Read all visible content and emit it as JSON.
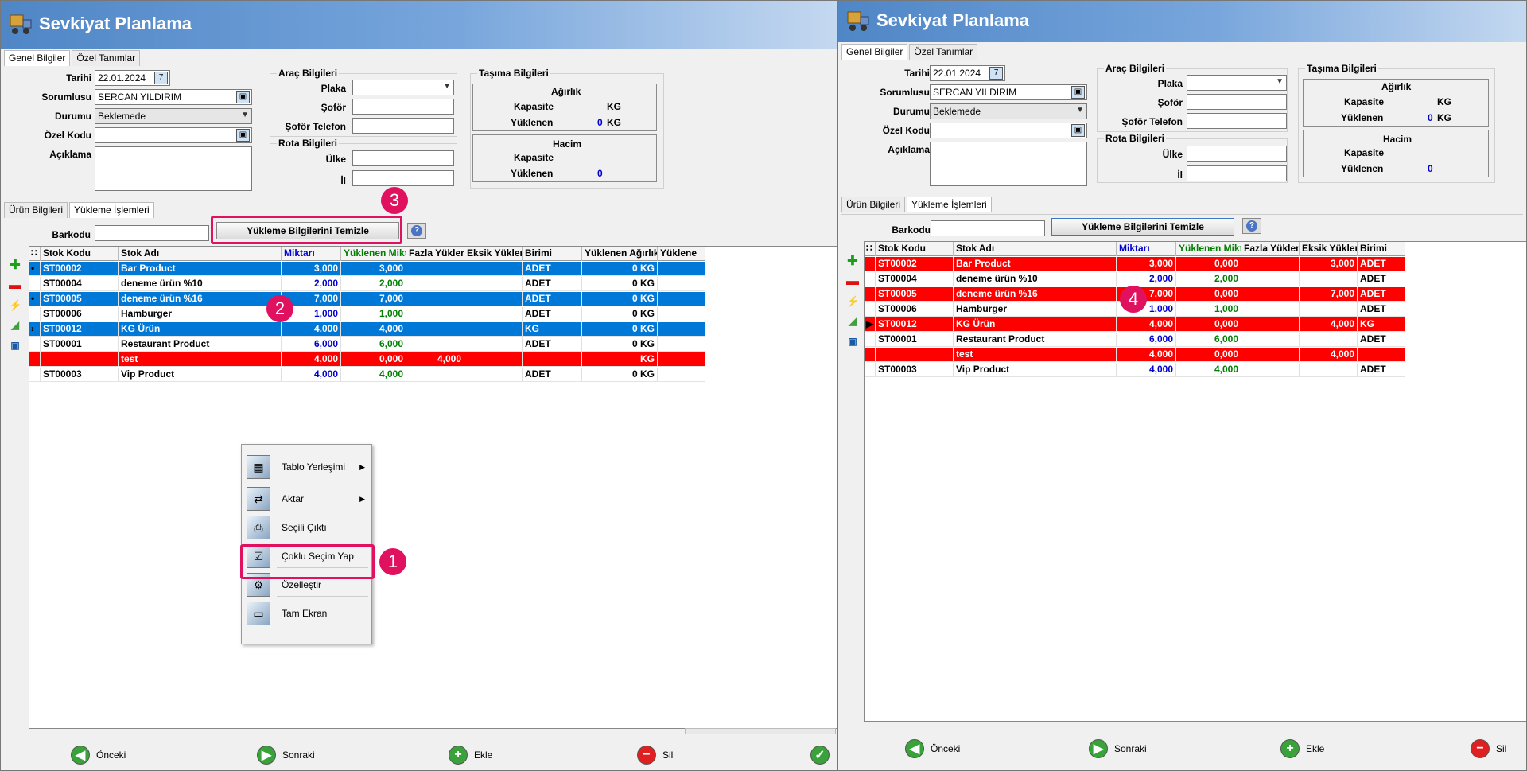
{
  "app_title": "Sevkiyat Planlama",
  "top_tabs": [
    "Genel Bilgiler",
    "Özel Tanımlar"
  ],
  "form": {
    "tarih_label": "Tarihi",
    "tarih_value": "22.01.2024",
    "sorumlu_label": "Sorumlusu",
    "sorumlu_value": "SERCAN YILDIRIM",
    "durum_label": "Durumu",
    "durum_value": "Beklemede",
    "ozel_kod_label": "Özel Kodu",
    "ozel_kod_value": "",
    "aciklama_label": "Açıklama",
    "aciklama_value": ""
  },
  "arac": {
    "title": "Araç Bilgileri",
    "plaka": "Plaka",
    "sofor": "Şoför",
    "sofor_tel": "Şoför Telefon"
  },
  "rota": {
    "title": "Rota Bilgileri",
    "ulke": "Ülke",
    "il": "İl"
  },
  "tasima": {
    "title": "Taşıma Bilgileri",
    "agirlik_title": "Ağırlık",
    "kapasite": "Kapasite",
    "yuklenen": "Yüklenen",
    "kg": "KG",
    "agirlik_yuklenen_value": "0",
    "hacim_title": "Hacim",
    "hacim_yuklenen_value": "0"
  },
  "lower_tabs": [
    "Ürün Bilgileri",
    "Yükleme İşlemleri"
  ],
  "barkod_label": "Barkodu",
  "clear_button": "Yükleme Bilgilerini Temizle",
  "grid_left": {
    "columns": [
      "Stok Kodu",
      "Stok Adı",
      "Miktarı",
      "Yüklenen Miktar",
      "Fazla Yüklenen",
      "Eksik Yüklenen",
      "Birimi",
      "Yüklenen Ağırlık",
      "Yüklene"
    ],
    "rows": [
      {
        "marker": "•",
        "style": "sel",
        "kod": "ST00002",
        "ad": "Bar Product",
        "miktar": "3,000",
        "yuklenen": "3,000",
        "fazla": "",
        "eksik": "",
        "birim": "ADET",
        "agirlik": "0 KG"
      },
      {
        "marker": "",
        "style": "",
        "kod": "ST00004",
        "ad": "deneme ürün %10",
        "miktar": "2,000",
        "yuklenen": "2,000",
        "fazla": "",
        "eksik": "",
        "birim": "ADET",
        "agirlik": "0 KG"
      },
      {
        "marker": "•",
        "style": "sel",
        "kod": "ST00005",
        "ad": "deneme ürün %16",
        "miktar": "7,000",
        "yuklenen": "7,000",
        "fazla": "",
        "eksik": "",
        "birim": "ADET",
        "agirlik": "0 KG"
      },
      {
        "marker": "",
        "style": "",
        "kod": "ST00006",
        "ad": "Hamburger",
        "miktar": "1,000",
        "yuklenen": "1,000",
        "fazla": "",
        "eksik": "",
        "birim": "ADET",
        "agirlik": "0 KG"
      },
      {
        "marker": "›",
        "style": "sel",
        "kod": "ST00012",
        "ad": "KG Ürün",
        "miktar": "4,000",
        "yuklenen": "4,000",
        "fazla": "",
        "eksik": "",
        "birim": "KG",
        "agirlik": "0 KG"
      },
      {
        "marker": "",
        "style": "",
        "kod": "ST00001",
        "ad": "Restaurant Product",
        "miktar": "6,000",
        "yuklenen": "6,000",
        "fazla": "",
        "eksik": "",
        "birim": "ADET",
        "agirlik": "0 KG"
      },
      {
        "marker": "",
        "style": "red",
        "kod": "",
        "ad": "test",
        "miktar": "4,000",
        "yuklenen": "0,000",
        "fazla": "4,000",
        "eksik": "",
        "birim": "",
        "agirlik": "KG"
      },
      {
        "marker": "",
        "style": "",
        "kod": "ST00003",
        "ad": "Vip Product",
        "miktar": "4,000",
        "yuklenen": "4,000",
        "fazla": "",
        "eksik": "",
        "birim": "ADET",
        "agirlik": "0 KG"
      }
    ]
  },
  "grid_right": {
    "columns": [
      "Stok Kodu",
      "Stok Adı",
      "Miktarı",
      "Yüklenen Miktar",
      "Fazla Yüklenen",
      "Eksik Yüklenen",
      "Birimi"
    ],
    "rows": [
      {
        "marker": "",
        "style": "red",
        "kod": "ST00002",
        "ad": "Bar Product",
        "miktar": "3,000",
        "yuklenen": "0,000",
        "fazla": "",
        "eksik": "3,000",
        "birim": "ADET"
      },
      {
        "marker": "",
        "style": "",
        "kod": "ST00004",
        "ad": "deneme ürün %10",
        "miktar": "2,000",
        "yuklenen": "2,000",
        "fazla": "",
        "eksik": "",
        "birim": "ADET"
      },
      {
        "marker": "",
        "style": "red",
        "kod": "ST00005",
        "ad": "deneme ürün %16",
        "miktar": "7,000",
        "yuklenen": "0,000",
        "fazla": "",
        "eksik": "7,000",
        "birim": "ADET"
      },
      {
        "marker": "",
        "style": "",
        "kod": "ST00006",
        "ad": "Hamburger",
        "miktar": "1,000",
        "yuklenen": "1,000",
        "fazla": "",
        "eksik": "",
        "birim": "ADET"
      },
      {
        "marker": "▶",
        "style": "red",
        "kod": "ST00012",
        "ad": "KG Ürün",
        "miktar": "4,000",
        "yuklenen": "0,000",
        "fazla": "",
        "eksik": "4,000",
        "birim": "KG"
      },
      {
        "marker": "",
        "style": "",
        "kod": "ST00001",
        "ad": "Restaurant Product",
        "miktar": "6,000",
        "yuklenen": "6,000",
        "fazla": "",
        "eksik": "",
        "birim": "ADET"
      },
      {
        "marker": "",
        "style": "red",
        "kod": "",
        "ad": "test",
        "miktar": "4,000",
        "yuklenen": "0,000",
        "fazla": "",
        "eksik": "4,000",
        "birim": ""
      },
      {
        "marker": "",
        "style": "",
        "kod": "ST00003",
        "ad": "Vip Product",
        "miktar": "4,000",
        "yuklenen": "4,000",
        "fazla": "",
        "eksik": "",
        "birim": "ADET"
      }
    ]
  },
  "context_menu": [
    {
      "label": "Tablo Yerleşimi",
      "icon": "table-icon",
      "submenu": true
    },
    {
      "label": "Aktar",
      "icon": "export-icon",
      "submenu": true
    },
    {
      "label": "Seçili Çıktı",
      "icon": "print-icon",
      "submenu": false
    },
    {
      "label": "Çoklu Seçim Yap",
      "icon": "multi-select-icon",
      "submenu": false
    },
    {
      "label": "Özelleştir",
      "icon": "customize-icon",
      "submenu": false
    },
    {
      "label": "Tam Ekran",
      "icon": "fullscreen-icon",
      "submenu": false
    }
  ],
  "footer": {
    "prev": "Önceki",
    "next": "Sonraki",
    "add": "Ekle",
    "delete": "Sil"
  },
  "badges": [
    "1",
    "2",
    "3",
    "4"
  ],
  "colors": {
    "title_blue": "#4f86c6",
    "selected_row": "#0078d7",
    "error_row": "#ff0000",
    "annotation": "#e0115f"
  }
}
